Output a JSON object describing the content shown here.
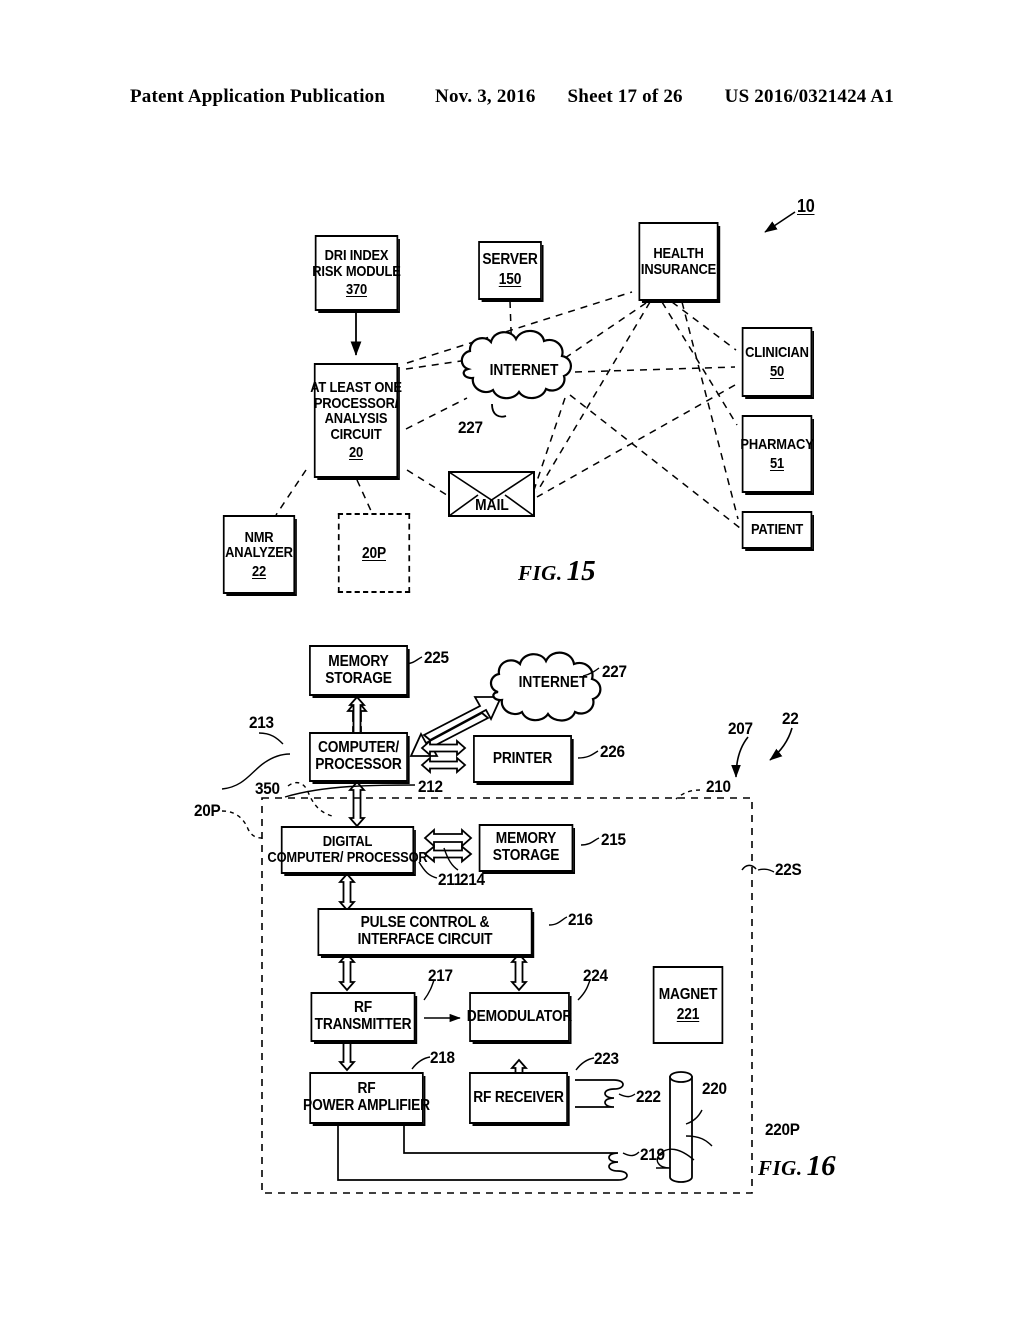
{
  "header": {
    "publication": "Patent Application Publication",
    "date": "Nov. 3, 2016",
    "sheet": "Sheet 17 of 26",
    "patent_number": "US 2016/0321424 A1"
  },
  "fig15": {
    "caption_word": "FIG.",
    "caption_number": "15",
    "system_ref": "10",
    "nodes": [
      {
        "id": "dri",
        "lines": [
          "DRI INDEX",
          "RISK MODULE"
        ],
        "num": "370"
      },
      {
        "id": "server",
        "lines": [
          "SERVER"
        ],
        "num": "150"
      },
      {
        "id": "health",
        "lines": [
          "HEALTH",
          "INSURANCE"
        ],
        "num": ""
      },
      {
        "id": "proc",
        "lines": [
          "AT LEAST ONE",
          "PROCESSOR/",
          "ANALYSIS",
          "CIRCUIT"
        ],
        "num": "20"
      },
      {
        "id": "clinician",
        "lines": [
          "CLINICIAN"
        ],
        "num": "50"
      },
      {
        "id": "pharmacy",
        "lines": [
          "PHARMACY"
        ],
        "num": "51"
      },
      {
        "id": "patient",
        "lines": [
          "PATIENT"
        ],
        "num": ""
      },
      {
        "id": "nmr",
        "lines": [
          "NMR",
          "ANALYZER"
        ],
        "num": "22"
      },
      {
        "id": "p20p",
        "lines": [],
        "num": "20P"
      }
    ],
    "internet_label": "INTERNET",
    "internet_ref": "227",
    "mail_label": "MAIL"
  },
  "fig16": {
    "caption_word": "FIG.",
    "caption_number": "16",
    "nodes": [
      {
        "id": "mem225",
        "lines": [
          "MEMORY",
          "STORAGE"
        ]
      },
      {
        "id": "cpu",
        "lines": [
          "COMPUTER/",
          "PROCESSOR"
        ]
      },
      {
        "id": "printer",
        "lines": [
          "PRINTER"
        ]
      },
      {
        "id": "digcpu",
        "lines": [
          "DIGITAL",
          "COMPUTER/ PROCESSOR"
        ]
      },
      {
        "id": "mem215",
        "lines": [
          "MEMORY",
          "STORAGE"
        ]
      },
      {
        "id": "pulse",
        "lines": [
          "PULSE CONTROL &",
          "INTERFACE CIRCUIT"
        ]
      },
      {
        "id": "rftx",
        "lines": [
          "RF",
          "TRANSMITTER"
        ]
      },
      {
        "id": "demod",
        "lines": [
          "DEMODULATOR"
        ]
      },
      {
        "id": "rfpa",
        "lines": [
          "RF",
          "POWER AMPLIFIER"
        ]
      },
      {
        "id": "rfrx",
        "lines": [
          "RF RECEIVER"
        ]
      },
      {
        "id": "magnet",
        "lines": [
          "MAGNET"
        ],
        "num": "221"
      }
    ],
    "internet_label": "INTERNET",
    "refs": {
      "r225": "225",
      "r227": "227",
      "r213": "213",
      "r226": "226",
      "r212": "212",
      "r350": "350",
      "r20p": "20P",
      "r211": "211",
      "r214": "214",
      "r215": "215",
      "r216": "216",
      "r217": "217",
      "r224": "224",
      "r218": "218",
      "r223": "223",
      "r222": "222",
      "r219": "219",
      "r220": "220",
      "r220p": "220P",
      "r210": "210",
      "r207": "207",
      "r22": "22",
      "r22s": "22S"
    }
  },
  "colors": {
    "ink": "#000000",
    "paper": "#ffffff"
  }
}
